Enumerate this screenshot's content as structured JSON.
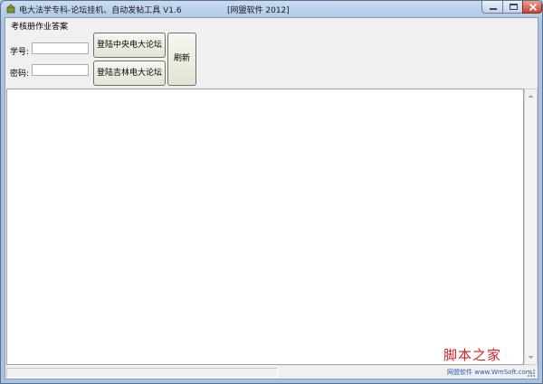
{
  "window": {
    "title": "电大法学专科-论坛挂机、自动发帖工具  V1.6",
    "title_right": "[网盟软件 2012]"
  },
  "menu": {
    "item": "考核册作业答案"
  },
  "form": {
    "student_id_label": "学号:",
    "student_id_value": "",
    "password_label": "密码:",
    "password_value": ""
  },
  "buttons": {
    "login_central": "登陆中央电大论坛",
    "login_jilin": "登陆吉林电大论坛",
    "refresh": "刷新"
  },
  "status": {
    "text": ""
  },
  "watermark": {
    "text": "脚本之家",
    "sub": "网盟软件 www.WmSoft.com"
  },
  "colors": {
    "accent": "#a8c4e4",
    "close_button": "#c7452b",
    "watermark": "#d4202a"
  }
}
